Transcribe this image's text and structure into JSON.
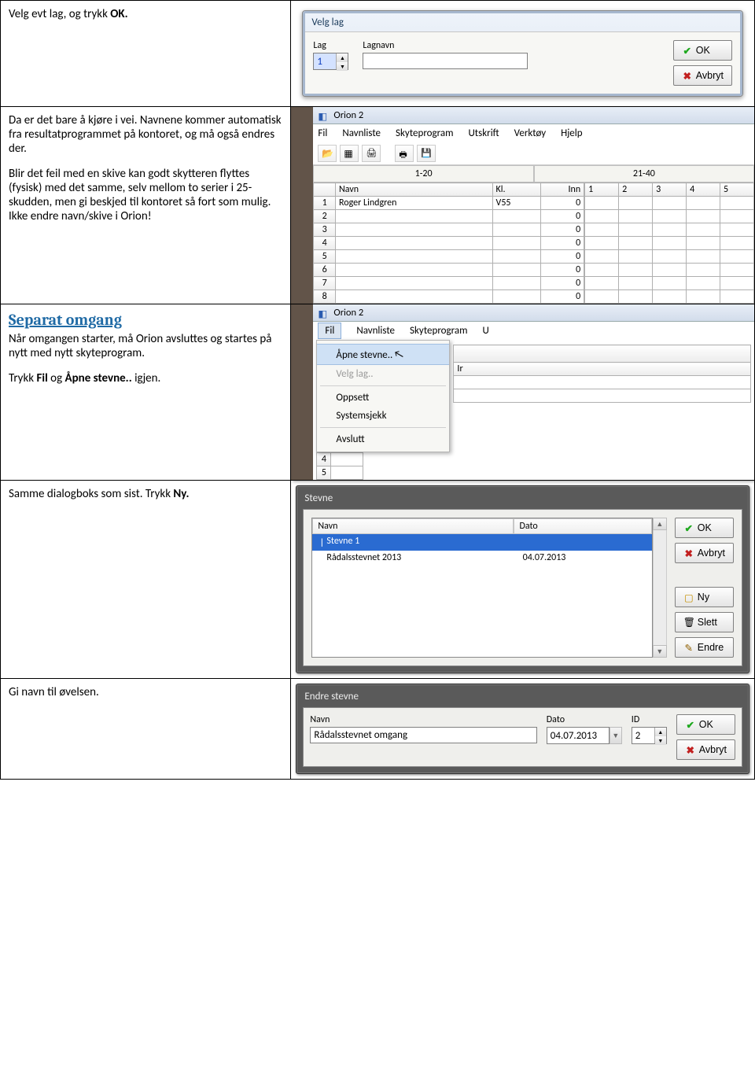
{
  "row1": {
    "instruction_pre": "Velg evt lag, og trykk ",
    "instruction_bold": "OK.",
    "dialog_title": "Velg lag",
    "lag_label": "Lag",
    "lag_value": "1",
    "lagnavn_label": "Lagnavn",
    "lagnavn_value": "",
    "ok": "OK",
    "cancel": "Avbryt"
  },
  "row2": {
    "p1": "Da er det bare å kjøre i vei. Navnene kommer automatisk fra resultatprogrammet på kontoret, og må også endres der.",
    "p2": "Blir det feil med en skive kan godt skytteren flyttes (fysisk) med det samme, selv mellom to serier i 25-skudden, men gi beskjed til kontoret så fort som mulig. Ikke endre navn/skive i Orion!",
    "app_title": "Orion 2",
    "menus": [
      "Fil",
      "Navnliste",
      "Skyteprogram",
      "Utskrift",
      "Verktøy",
      "Hjelp"
    ],
    "tabs": [
      "1-20",
      "21-40"
    ],
    "cols_left": [
      "",
      "Navn",
      "Kl.",
      "Inn"
    ],
    "cols_right": [
      "1",
      "2",
      "3",
      "4",
      "5"
    ],
    "rows": [
      {
        "n": "1",
        "navn": "Roger Lindgren",
        "kl": "V55",
        "inn": "0"
      },
      {
        "n": "2",
        "navn": "",
        "kl": "",
        "inn": "0"
      },
      {
        "n": "3",
        "navn": "",
        "kl": "",
        "inn": "0"
      },
      {
        "n": "4",
        "navn": "",
        "kl": "",
        "inn": "0"
      },
      {
        "n": "5",
        "navn": "",
        "kl": "",
        "inn": "0"
      },
      {
        "n": "6",
        "navn": "",
        "kl": "",
        "inn": "0"
      },
      {
        "n": "7",
        "navn": "",
        "kl": "",
        "inn": "0"
      },
      {
        "n": "8",
        "navn": "",
        "kl": "",
        "inn": "0"
      }
    ]
  },
  "row3": {
    "heading": "Separat omgang",
    "p1": "Når omgangen starter, må Orion avsluttes og startes på nytt med nytt skyteprogram.",
    "p2_pre": "Trykk ",
    "p2_b1": "Fil",
    "p2_mid": " og ",
    "p2_b2": "Åpne stevne..",
    "p2_post": " igjen.",
    "app_title": "Orion 2",
    "menus": [
      "Fil",
      "Navnliste",
      "Skyteprogram",
      "U"
    ],
    "dropdown": {
      "open": "Åpne stevne..",
      "velg": "Velg lag..",
      "oppsett": "Oppsett",
      "systemsjekk": "Systemsjekk",
      "avslutt": "Avslutt"
    },
    "side_label": "Ir",
    "rownums": [
      "4",
      "5"
    ]
  },
  "row4": {
    "instruction_pre": "Samme dialogboks som sist. Trykk ",
    "instruction_bold": "Ny.",
    "dialog_title": "Stevne",
    "col_name": "Navn",
    "col_date": "Dato",
    "items": [
      {
        "name": "Stevne 1",
        "date": ""
      },
      {
        "name": "Rådalsstevnet 2013",
        "date": "04.07.2013"
      }
    ],
    "ok": "OK",
    "cancel": "Avbryt",
    "ny": "Ny",
    "slett": "Slett",
    "endre": "Endre"
  },
  "row5": {
    "instruction": "Gi navn til øvelsen.",
    "dialog_title": "Endre stevne",
    "name_label": "Navn",
    "name_value": "Rådalsstevnet omgang",
    "date_label": "Dato",
    "date_value": "04.07.2013",
    "id_label": "ID",
    "id_value": "2",
    "ok": "OK",
    "cancel": "Avbryt"
  }
}
